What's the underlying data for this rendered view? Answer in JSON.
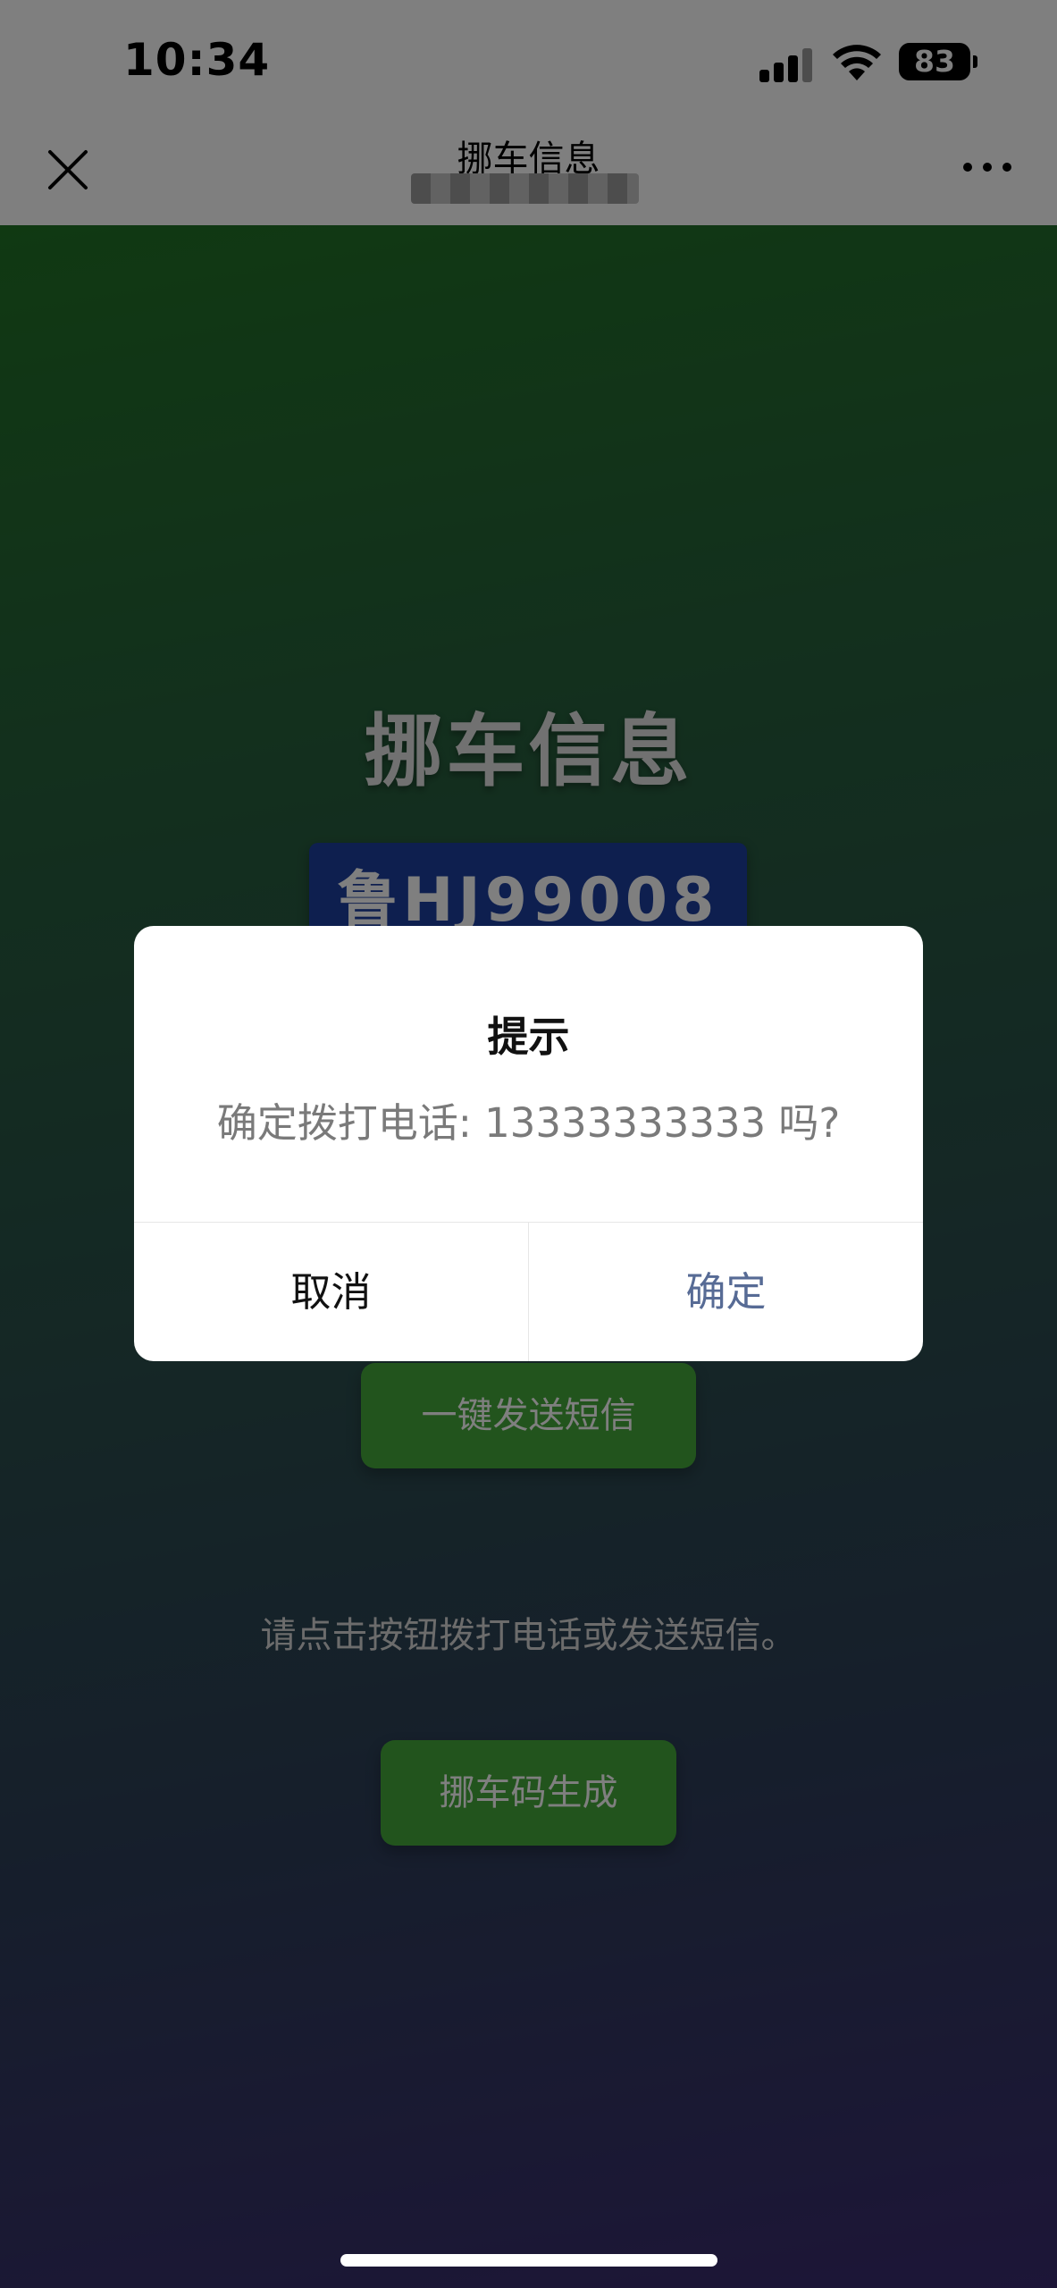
{
  "status_bar": {
    "time": "10:34",
    "battery": "83"
  },
  "navbar": {
    "title": "挪车信息"
  },
  "main": {
    "title": "挪车信息",
    "plate": "鲁HJ99008",
    "sms_button": "一键发送短信",
    "hint": "请点击按钮拨打电话或发送短信。",
    "generate_button": "挪车码生成"
  },
  "dialog": {
    "title": "提示",
    "message": "确定拨打电话: 13333333333 吗?",
    "cancel": "取消",
    "confirm": "确定"
  },
  "colors": {
    "accent_green": "#45a83a",
    "plate_blue": "#1c3e9e",
    "confirm_blue": "#576b95"
  }
}
